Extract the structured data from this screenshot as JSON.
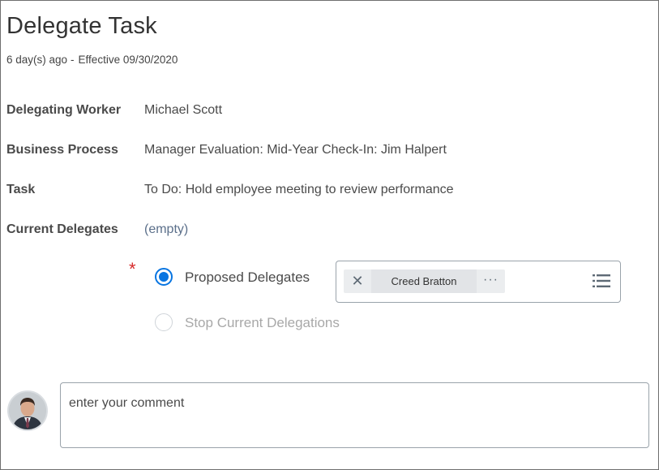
{
  "header": {
    "title": "Delegate Task",
    "age": "6 day(s) ago",
    "separator": "-",
    "effective": "Effective 09/30/2020"
  },
  "fields": {
    "delegating_worker": {
      "label": "Delegating Worker",
      "value": "Michael Scott"
    },
    "business_process": {
      "label": "Business Process",
      "value": "Manager Evaluation: Mid-Year Check-In: Jim Halpert"
    },
    "task": {
      "label": "Task",
      "value": "To Do: Hold employee meeting to review performance"
    },
    "current_delegates": {
      "label": "Current Delegates",
      "value": "(empty)"
    }
  },
  "delegation_options": {
    "required_marker": "*",
    "proposed": {
      "label": "Proposed Delegates",
      "selected": true
    },
    "stop": {
      "label": "Stop Current Delegations",
      "selected": false,
      "disabled": true
    },
    "selected_delegates": [
      {
        "name": "Creed Bratton",
        "remove_symbol": "✕",
        "more_symbol": "···"
      }
    ]
  },
  "comment": {
    "placeholder": "enter your comment"
  },
  "colors": {
    "accent": "#0875e1",
    "required": "#d62a2a",
    "text": "#333333"
  },
  "icons": {
    "remove": "close-icon",
    "more": "more-options-icon",
    "prompt_list": "list-icon",
    "avatar": "user-avatar"
  }
}
